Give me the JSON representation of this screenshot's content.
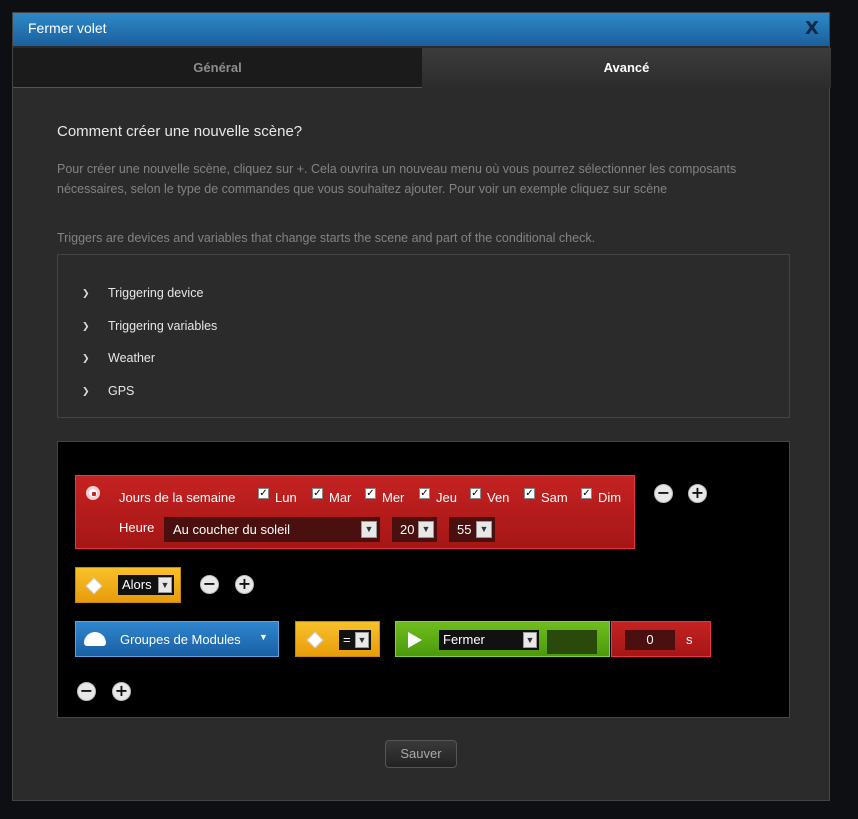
{
  "window": {
    "title": "Fermer volet",
    "close_label": "X"
  },
  "tabs": [
    {
      "label": "Général",
      "active": false
    },
    {
      "label": "Avancé",
      "active": true
    }
  ],
  "help": {
    "heading": "Comment créer une nouvelle scène?",
    "description": "Pour créer une nouvelle scène, cliquez sur +. Cela ouvrira un nouveau menu où vous pourrez sélectionner les composants nécessaires, selon le type de commandes que vous souhaitez ajouter. Pour voir un exemple cliquez sur scène",
    "triggers_note": "Triggers are devices and variables that change starts the scene and part of the conditional check."
  },
  "accordion": {
    "items": [
      {
        "label": "Triggering device"
      },
      {
        "label": "Triggering variables"
      },
      {
        "label": "Weather"
      },
      {
        "label": "GPS"
      }
    ]
  },
  "scene": {
    "time_block": {
      "days_label": "Jours de la semaine",
      "days": [
        {
          "label": "Lun",
          "checked": true
        },
        {
          "label": "Mar",
          "checked": true
        },
        {
          "label": "Mer",
          "checked": true
        },
        {
          "label": "Jeu",
          "checked": true
        },
        {
          "label": "Ven",
          "checked": true
        },
        {
          "label": "Sam",
          "checked": true
        },
        {
          "label": "Dim",
          "checked": true
        }
      ],
      "time_label": "Heure",
      "time_mode": "Au coucher du soleil",
      "offset_hours": "20",
      "offset_minutes": "55"
    },
    "condition_block": {
      "operator": "Alors"
    },
    "action_row": {
      "group_label": "Groupes de Modules",
      "comparator": "=",
      "action": "Fermer",
      "delay_value": "0",
      "delay_unit": "s"
    }
  },
  "footer": {
    "save_label": "Sauver"
  },
  "colors": {
    "titlebar": "#1f6fb0",
    "time_block": "#b81c1c",
    "condition_block": "#f0ad1a",
    "group_block": "#2576bd",
    "action_block": "#5fae14"
  }
}
